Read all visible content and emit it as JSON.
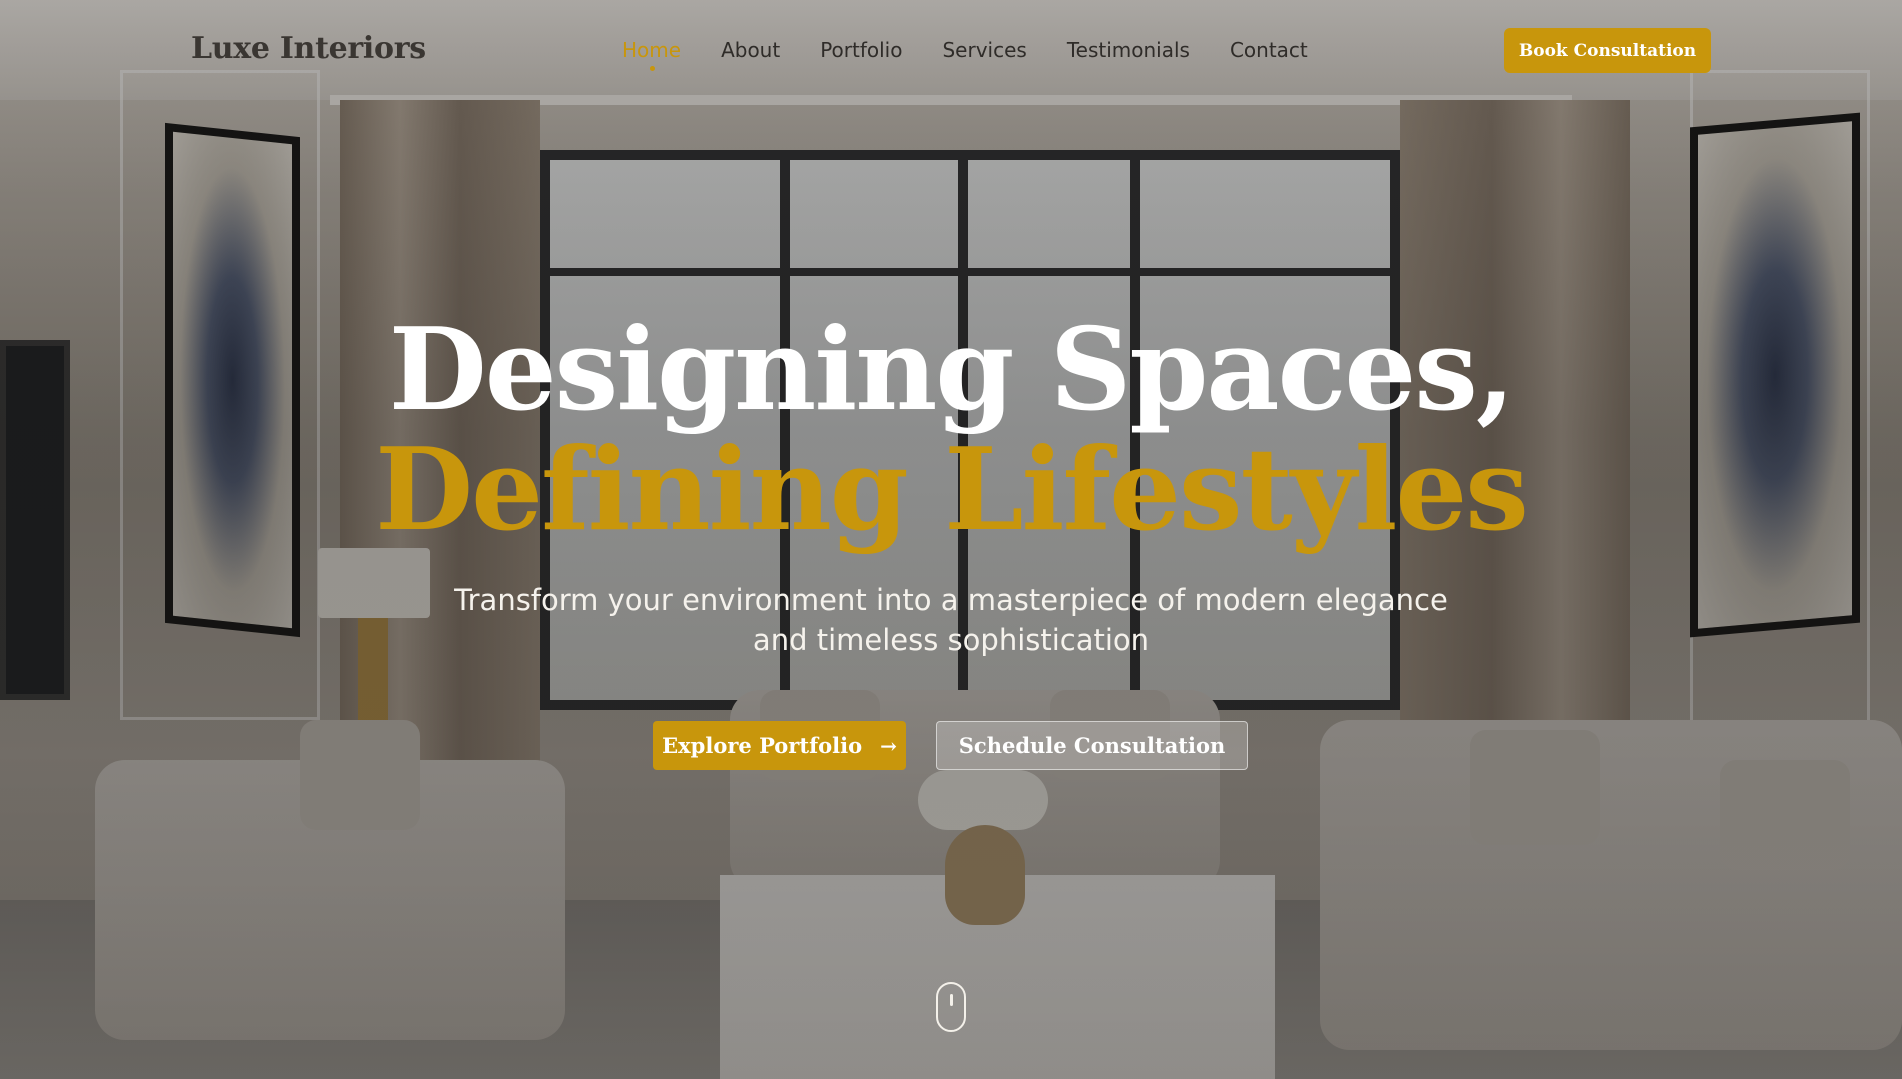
{
  "brand": {
    "logo": "Luxe Interiors"
  },
  "nav": {
    "links": [
      {
        "label": "Home",
        "active": true
      },
      {
        "label": "About",
        "active": false
      },
      {
        "label": "Portfolio",
        "active": false
      },
      {
        "label": "Services",
        "active": false
      },
      {
        "label": "Testimonials",
        "active": false
      },
      {
        "label": "Contact",
        "active": false
      }
    ],
    "cta": "Book Consultation"
  },
  "hero": {
    "headline_line1": "Designing Spaces,",
    "headline_line2": "Defining Lifestyles",
    "subtitle": "Transform your environment into a masterpiece of modern elegance and timeless sophistication",
    "primary_button": "Explore Portfolio",
    "primary_button_icon": "arrow-right-icon",
    "secondary_button": "Schedule Consultation",
    "scroll_icon": "mouse-scroll-icon"
  },
  "colors": {
    "accent": "#c8960c",
    "text_light": "#ffffff",
    "text_dark": "#2f2c29"
  }
}
